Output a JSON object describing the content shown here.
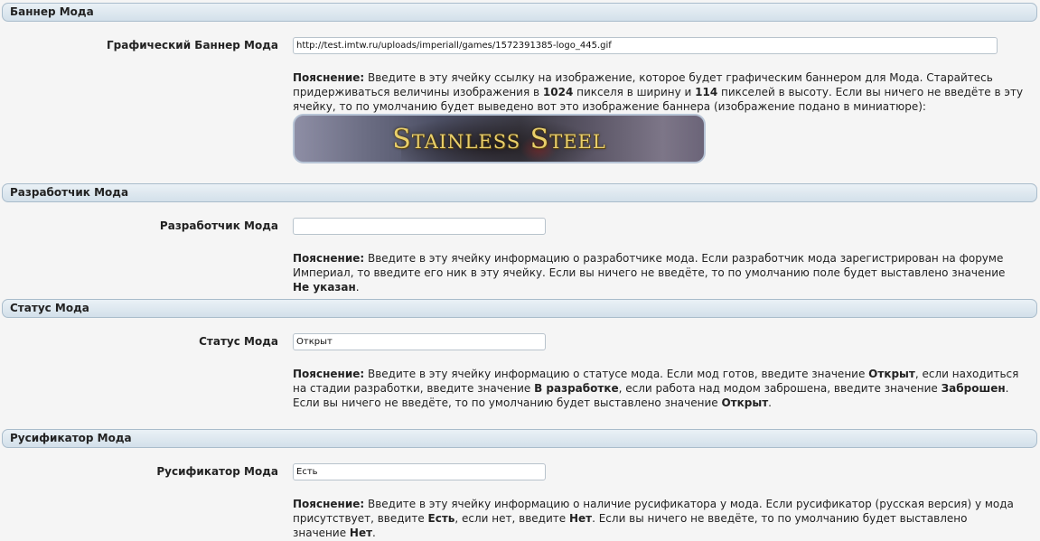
{
  "sections": {
    "banner": {
      "header": "Баннер Мода",
      "label": "Графический Баннер Мода",
      "value": "http://test.imtw.ru/uploads/imperiall/games/1572391385-logo_445.gif",
      "desc": {
        "prefix": "Пояснение:",
        "t1": " Введите в эту ячейку ссылку на изображение, которое будет графическим баннером для Мода. Старайтесь придерживаться величины изображения в ",
        "b1": "1024",
        "t2": " пикселя в ширину и ",
        "b2": "114",
        "t3": " пикселей в высоту. Если вы ничего не введёте в эту ячейку, то по умолчанию будет выведено вот это изображение баннера (изображение подано в миниатюре):"
      },
      "banner_text": "Stainless Steel"
    },
    "developer": {
      "header": "Разработчик Мода",
      "label": "Разработчик Мода",
      "value": "",
      "desc": {
        "prefix": "Пояснение:",
        "t1": " Введите в эту ячейку информацию о разработчике мода. Если разработчик мода зарегистрирован на форуме Империал, то введите его ник в эту ячейку. Если вы ничего не введёте, то по умолчанию поле будет выставлено значение ",
        "b1": "Не указан",
        "t2": "."
      }
    },
    "status": {
      "header": "Статус Мода",
      "label": "Статус Мода",
      "value": "Открыт",
      "desc": {
        "prefix": "Пояснение:",
        "t1": " Введите в эту ячейку информацию о статусе мода. Если мод готов, введите значение ",
        "b1": "Открыт",
        "t2": ", если находиться на стадии разработки, введите значение ",
        "b2": "В разработке",
        "t3": ", если работа над модом заброшена, введите значение ",
        "b3": "Заброшен",
        "t4": ". Если вы ничего не введёте, то по умолчанию будет выставлено значение ",
        "b4": "Открыт",
        "t5": "."
      }
    },
    "rusifikator": {
      "header": "Русификатор Мода",
      "label": "Русификатор Мода",
      "value": "Есть",
      "desc": {
        "prefix": "Пояснение:",
        "t1": " Введите в эту ячейку информацию о наличие русификатора у мода. Если русификатор (русская версия) у мода присутствует, введите ",
        "b1": "Есть",
        "t2": ", если нет, введите ",
        "b2": "Нет",
        "t3": ". Если вы ничего не введёте, то по умолчанию будет выставлено значение ",
        "b3": "Нет",
        "t4": "."
      }
    }
  }
}
